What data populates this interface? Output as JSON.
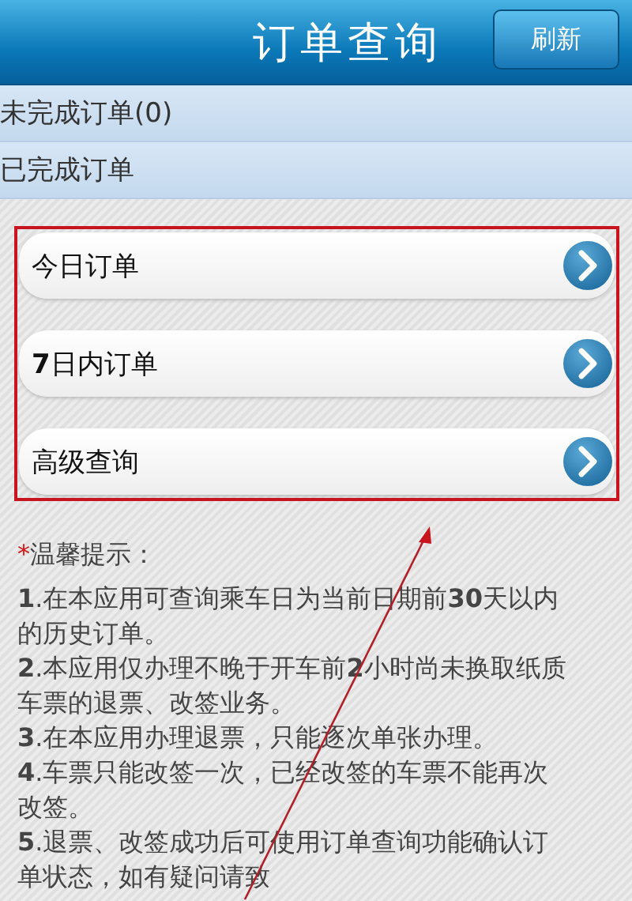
{
  "header": {
    "title": "订单查询",
    "refresh_button": "刷新"
  },
  "sections": [
    {
      "label": "未完成订单(0)"
    },
    {
      "label": "已完成订单"
    }
  ],
  "menu_items": [
    {
      "label": "今日订单"
    },
    {
      "label": "**7**日内订单"
    },
    {
      "label": "高级查询"
    }
  ],
  "tips": {
    "title": "温馨提示：",
    "marker": "*",
    "items": [
      "**1**.在本应用可查询乘车日为当前日期前**30**天以内的历史订单。",
      "**2**.本应用仅办理不晚于开车前**2**小时尚未换取纸质车票的退票、改签业务。",
      "**3**.在本应用办理退票，只能逐次单张办理。",
      "**4**.车票只能改签一次，已经改签的车票不能再次改签。",
      "**5**.退票、改签成功后可使用订单查询功能确认订单状态，如有疑问请致"
    ]
  }
}
